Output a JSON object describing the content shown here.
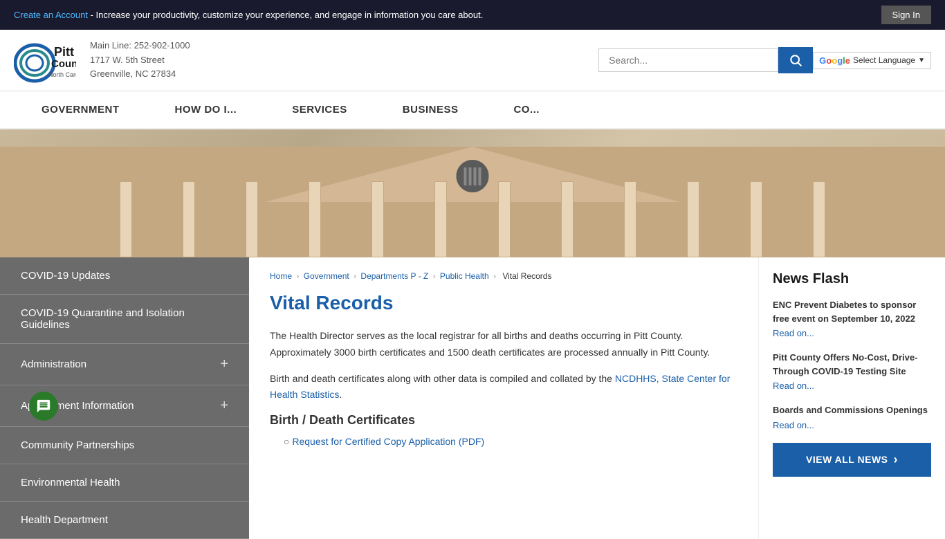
{
  "topbar": {
    "cta_link": "Create an Account",
    "cta_text": " - Increase your productivity, customize your experience, and engage in information you care about.",
    "signin_label": "Sign In"
  },
  "header": {
    "logo_alt": "Pitt County North Carolina",
    "main_line_label": "Main Line: 252-902-1000",
    "address_line1": "1717 W. 5th Street",
    "address_line2": "Greenville, NC 27834",
    "search_placeholder": "Search...",
    "translate_label": "Select Language"
  },
  "nav": {
    "items": [
      {
        "label": "GOVERNMENT",
        "id": "government"
      },
      {
        "label": "HOW DO I...",
        "id": "how-do-i"
      },
      {
        "label": "SERVICES",
        "id": "services"
      },
      {
        "label": "BUSINESS",
        "id": "business"
      },
      {
        "label": "CO...",
        "id": "community"
      }
    ]
  },
  "breadcrumb": {
    "items": [
      {
        "label": "Home",
        "href": "#"
      },
      {
        "label": "Government",
        "href": "#"
      },
      {
        "label": "Departments P - Z",
        "href": "#"
      },
      {
        "label": "Public Health",
        "href": "#"
      }
    ],
    "current": "Vital Records"
  },
  "sidebar": {
    "items": [
      {
        "label": "COVID-19 Updates",
        "has_plus": false
      },
      {
        "label": "COVID-19 Quarantine and Isolation Guidelines",
        "has_plus": false
      },
      {
        "label": "Administration",
        "has_plus": true
      },
      {
        "label": "Appointment Information",
        "has_plus": true
      },
      {
        "label": "Community Partnerships",
        "has_plus": false
      },
      {
        "label": "Environmental Health",
        "has_plus": false
      },
      {
        "label": "Health Department",
        "has_plus": false
      }
    ]
  },
  "main": {
    "title": "Vital Records",
    "body_p1": "The Health Director serves as the local registrar for all births and deaths occurring in Pitt County. Approximately 3000 birth certificates and 1500 death certificates are processed annually in Pitt County.",
    "body_p2": "Birth and death certificates along with other data is compiled and collated by the ",
    "body_p2_link": "NCDHHS, State Center for Health Statistics",
    "body_p2_end": ".",
    "section_title": "Birth / Death Certificates",
    "cert_link": "Request for Certified Copy Application (PDF)"
  },
  "news": {
    "title": "News Flash",
    "items": [
      {
        "text": "ENC Prevent Diabetes to sponsor free event on September 10, 2022",
        "read_on": "Read on..."
      },
      {
        "text": "Pitt County Offers No-Cost, Drive-Through COVID-19 Testing Site",
        "read_on": "Read on..."
      },
      {
        "text": "Boards and Commissions Openings",
        "read_on": "Read on..."
      }
    ],
    "view_all_label": "VIEW ALL NEWS"
  }
}
